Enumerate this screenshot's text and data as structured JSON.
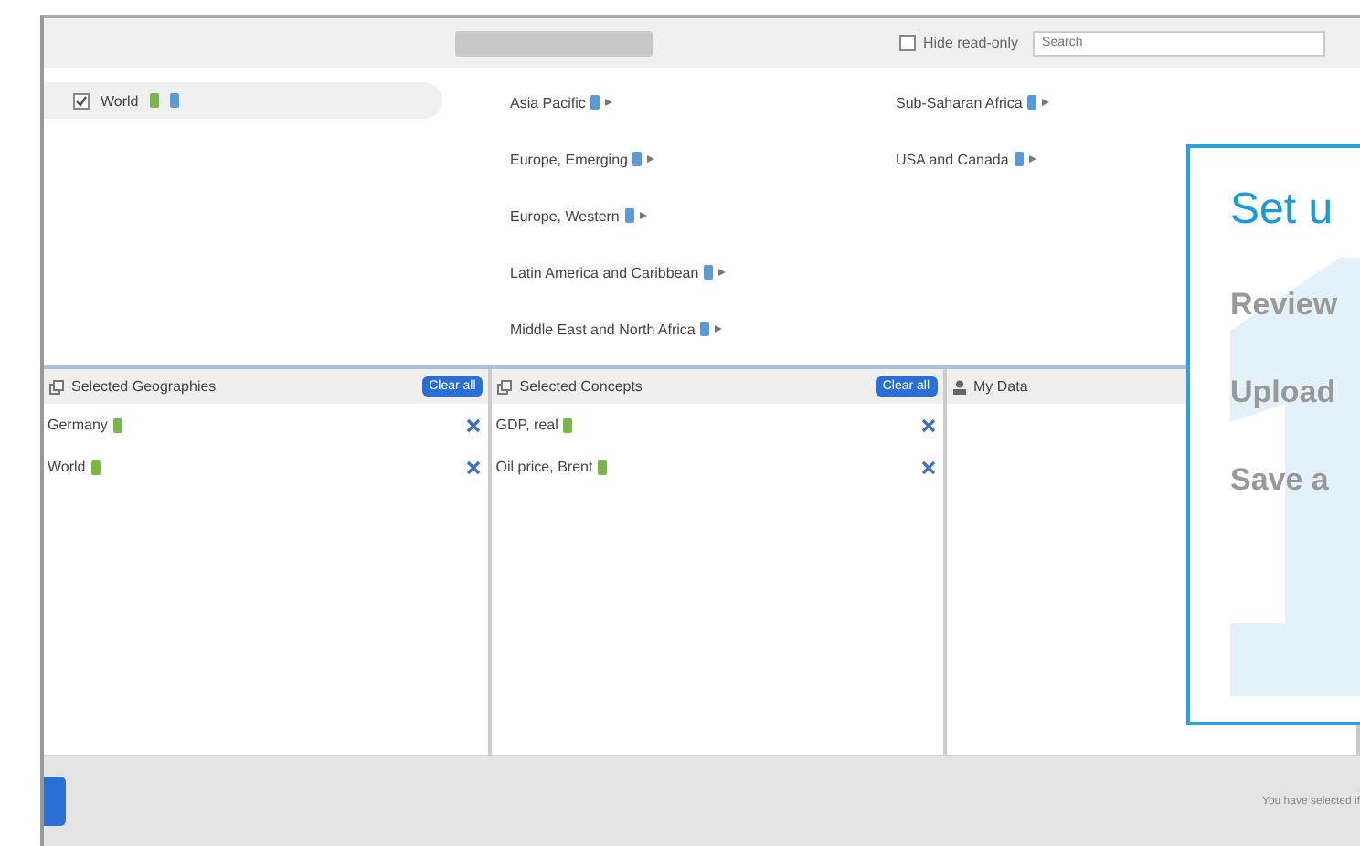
{
  "toolbar": {
    "hide_read_only": {
      "label": "Hide read-only",
      "checked": false
    },
    "search": {
      "placeholder": "Search"
    }
  },
  "tree": [
    {
      "label": "World",
      "checked": true,
      "badges": [
        {
          "color": "#7ab648"
        },
        {
          "color": "#5b9bd5"
        }
      ]
    }
  ],
  "regions": [
    {
      "label": "Asia Pacific",
      "badges": [
        {
          "color": "#5b9bd5"
        }
      ]
    },
    {
      "label": "Europe, Emerging",
      "badges": [
        {
          "color": "#5b9bd5"
        }
      ]
    },
    {
      "label": "Europe, Western",
      "badges": [
        {
          "color": "#5b9bd5"
        }
      ]
    },
    {
      "label": "Latin America and Caribbean",
      "badges": [
        {
          "color": "#5b9bd5"
        }
      ]
    },
    {
      "label": "Middle East and North Africa",
      "badges": [
        {
          "color": "#5b9bd5"
        }
      ]
    },
    {
      "label": "Sub-Saharan Africa",
      "badges": [
        {
          "color": "#5b9bd5"
        }
      ]
    },
    {
      "label": "USA and Canada",
      "badges": [
        {
          "color": "#5b9bd5"
        }
      ]
    }
  ],
  "panels": [
    {
      "kind": "list",
      "title": "Selected Geographies",
      "clear": "Clear all",
      "items": [
        {
          "label": "Germany",
          "badges": [
            {
              "color": "#7ab648"
            }
          ]
        },
        {
          "label": "World",
          "badges": [
            {
              "color": "#7ab648"
            }
          ]
        }
      ]
    },
    {
      "kind": "list",
      "title": "Selected Concepts",
      "clear": "Clear all",
      "items": [
        {
          "label": "GDP, real",
          "badges": [
            {
              "color": "#7ab648"
            }
          ]
        },
        {
          "label": "Oil price, Brent",
          "badges": [
            {
              "color": "#7ab648"
            }
          ]
        }
      ]
    },
    {
      "kind": "user",
      "title": "My Data"
    }
  ],
  "footer": {
    "status": "You have selected if"
  },
  "card": {
    "title": "Set u",
    "steps": [
      "Review",
      "Upload",
      "Save a"
    ]
  }
}
